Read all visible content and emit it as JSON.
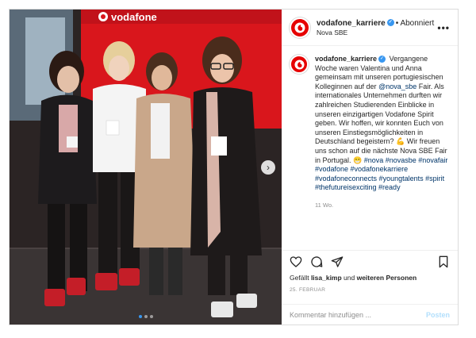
{
  "account": {
    "username": "vodafone_karriere",
    "follow_label": "• Abonniert",
    "location": "Nova SBE",
    "more_label": "•••"
  },
  "photo": {
    "banner_text": "vodafone",
    "next_icon": "›",
    "dots": 3,
    "active_dot": 0,
    "colors": {
      "banner_red": "#e60000",
      "background": "#2b2424"
    }
  },
  "caption": {
    "username": "vodafone_karriere",
    "text_part1": "Vergangene Woche waren Valentina und Anna gemeinsam mit unseren portugiesischen Kolleginnen auf der ",
    "mention": "@nova_sbe",
    "text_part2": " Fair. Als internationales Unternehmen durften wir zahlreichen Studierenden Einblicke in unseren einzigartigen Vodafone Spirit geben. Wir hoffen, wir konnten Euch von unseren Einstiegsmöglichkeiten in Deutschland begeistern? 💪 Wir freuen uns schon auf die nächste Nova SBE Fair in Portugal. 😁",
    "hashtags": "#nova #novasbe #novafair #vodafone #vodafonekarriere #vodafoneconnects #youngtalents #spirit #thefutureisexciting #ready",
    "time_ago": "11 Wo."
  },
  "engagement": {
    "likes_prefix": "Gefällt ",
    "liked_by": "lisa_kimp",
    "likes_middle": " und ",
    "likes_others": "weiteren Personen",
    "date": "25. FEBRUAR"
  },
  "comment": {
    "placeholder": "Kommentar hinzufügen ...",
    "post_label": "Posten"
  },
  "icons": [
    "heart-icon",
    "comment-icon",
    "share-icon",
    "bookmark-icon",
    "verified-icon",
    "vodafone-logo-icon"
  ]
}
